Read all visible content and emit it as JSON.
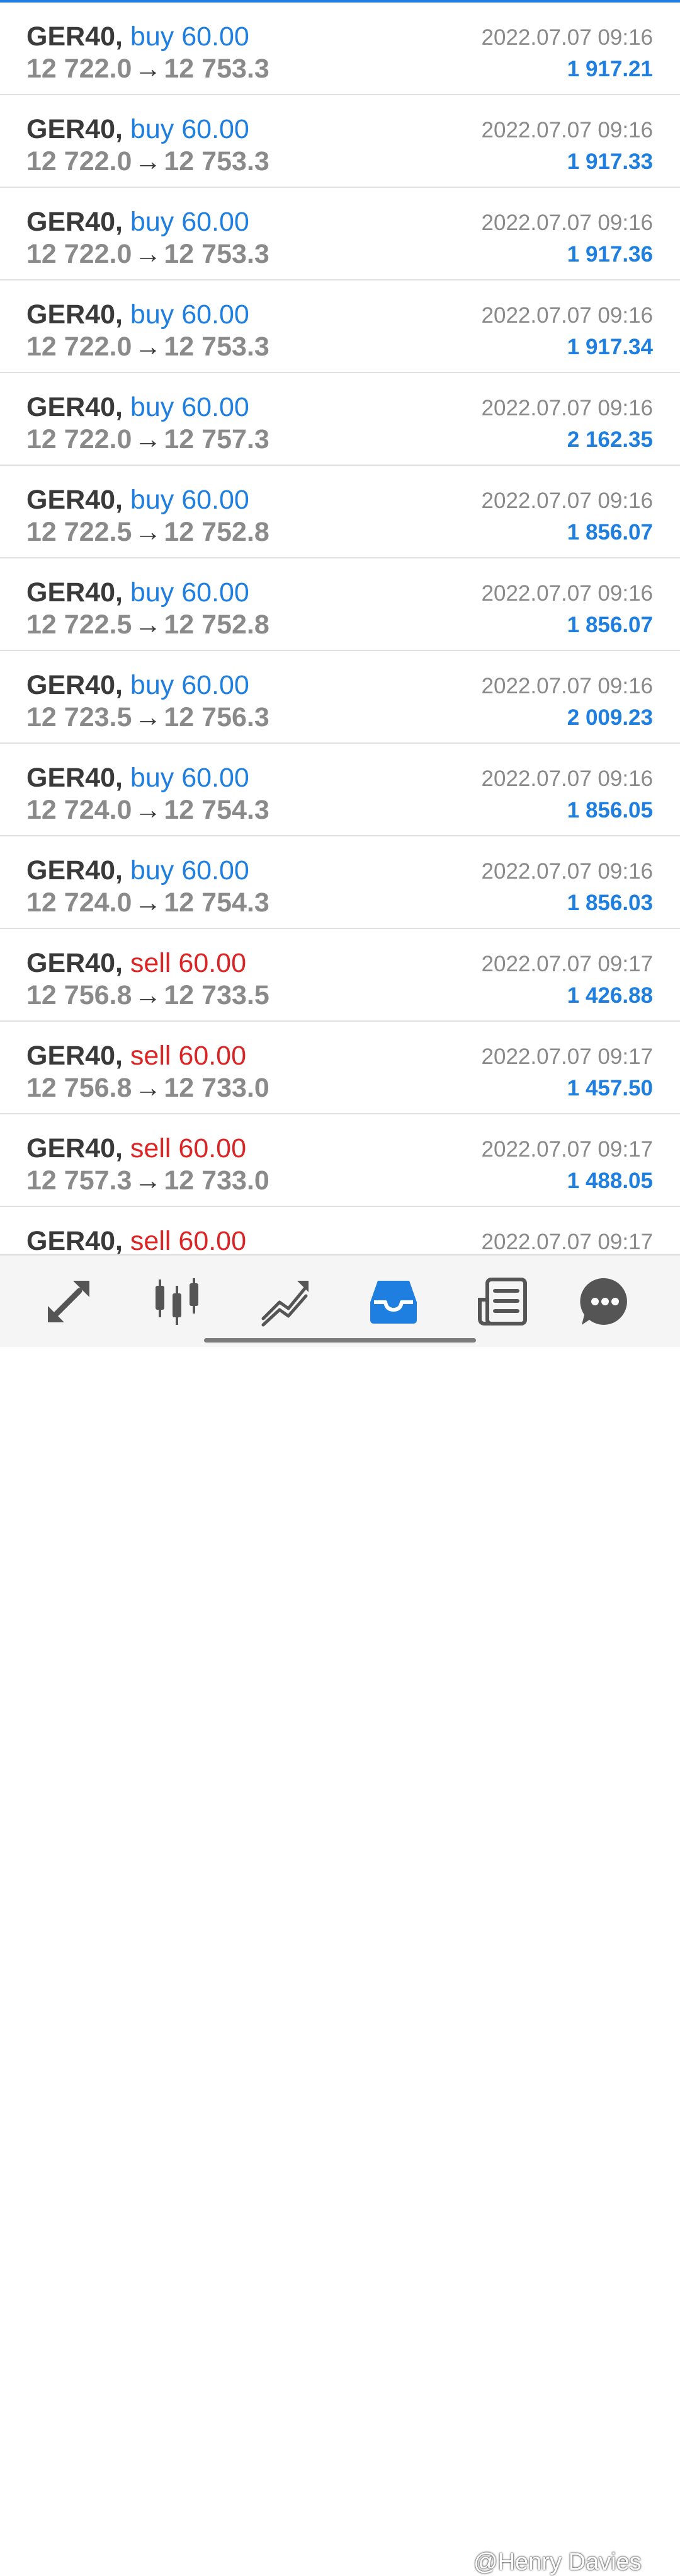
{
  "trades": [
    {
      "symbol": "GER40",
      "side": "buy",
      "volume": "60.00",
      "price_open": "12 722.0",
      "price_close": "12 753.3",
      "time": "2022.07.07 09:16",
      "profit": "1 917.21"
    },
    {
      "symbol": "GER40",
      "side": "buy",
      "volume": "60.00",
      "price_open": "12 722.0",
      "price_close": "12 753.3",
      "time": "2022.07.07 09:16",
      "profit": "1 917.33"
    },
    {
      "symbol": "GER40",
      "side": "buy",
      "volume": "60.00",
      "price_open": "12 722.0",
      "price_close": "12 753.3",
      "time": "2022.07.07 09:16",
      "profit": "1 917.36"
    },
    {
      "symbol": "GER40",
      "side": "buy",
      "volume": "60.00",
      "price_open": "12 722.0",
      "price_close": "12 753.3",
      "time": "2022.07.07 09:16",
      "profit": "1 917.34"
    },
    {
      "symbol": "GER40",
      "side": "buy",
      "volume": "60.00",
      "price_open": "12 722.0",
      "price_close": "12 757.3",
      "time": "2022.07.07 09:16",
      "profit": "2 162.35"
    },
    {
      "symbol": "GER40",
      "side": "buy",
      "volume": "60.00",
      "price_open": "12 722.5",
      "price_close": "12 752.8",
      "time": "2022.07.07 09:16",
      "profit": "1 856.07"
    },
    {
      "symbol": "GER40",
      "side": "buy",
      "volume": "60.00",
      "price_open": "12 722.5",
      "price_close": "12 752.8",
      "time": "2022.07.07 09:16",
      "profit": "1 856.07"
    },
    {
      "symbol": "GER40",
      "side": "buy",
      "volume": "60.00",
      "price_open": "12 723.5",
      "price_close": "12 756.3",
      "time": "2022.07.07 09:16",
      "profit": "2 009.23"
    },
    {
      "symbol": "GER40",
      "side": "buy",
      "volume": "60.00",
      "price_open": "12 724.0",
      "price_close": "12 754.3",
      "time": "2022.07.07 09:16",
      "profit": "1 856.05"
    },
    {
      "symbol": "GER40",
      "side": "buy",
      "volume": "60.00",
      "price_open": "12 724.0",
      "price_close": "12 754.3",
      "time": "2022.07.07 09:16",
      "profit": "1 856.03"
    },
    {
      "symbol": "GER40",
      "side": "sell",
      "volume": "60.00",
      "price_open": "12 756.8",
      "price_close": "12 733.5",
      "time": "2022.07.07 09:17",
      "profit": "1 426.88"
    },
    {
      "symbol": "GER40",
      "side": "sell",
      "volume": "60.00",
      "price_open": "12 756.8",
      "price_close": "12 733.0",
      "time": "2022.07.07 09:17",
      "profit": "1 457.50"
    },
    {
      "symbol": "GER40",
      "side": "sell",
      "volume": "60.00",
      "price_open": "12 757.3",
      "price_close": "12 733.0",
      "time": "2022.07.07 09:17",
      "profit": "1 488.05"
    },
    {
      "symbol": "GER40",
      "side": "sell",
      "volume": "60.00",
      "price_open": "",
      "price_close": "",
      "time": "2022.07.07 09:17",
      "profit": ""
    }
  ],
  "colors": {
    "buy": "#1e7fe0",
    "sell": "#dd2323",
    "profit": "#1e7fe0",
    "active_tab": "#1e7fe0",
    "inactive_tab": "#555555"
  },
  "tabbar": {
    "tabs": [
      {
        "icon": "quotes-arrows-icon",
        "active": false
      },
      {
        "icon": "chart-candles-icon",
        "active": false
      },
      {
        "icon": "trade-line-icon",
        "active": false
      },
      {
        "icon": "history-inbox-icon",
        "active": true
      },
      {
        "icon": "news-icon",
        "active": false
      },
      {
        "icon": "chat-bubble-icon",
        "active": false
      }
    ]
  },
  "watermark": "@Henry Davies"
}
